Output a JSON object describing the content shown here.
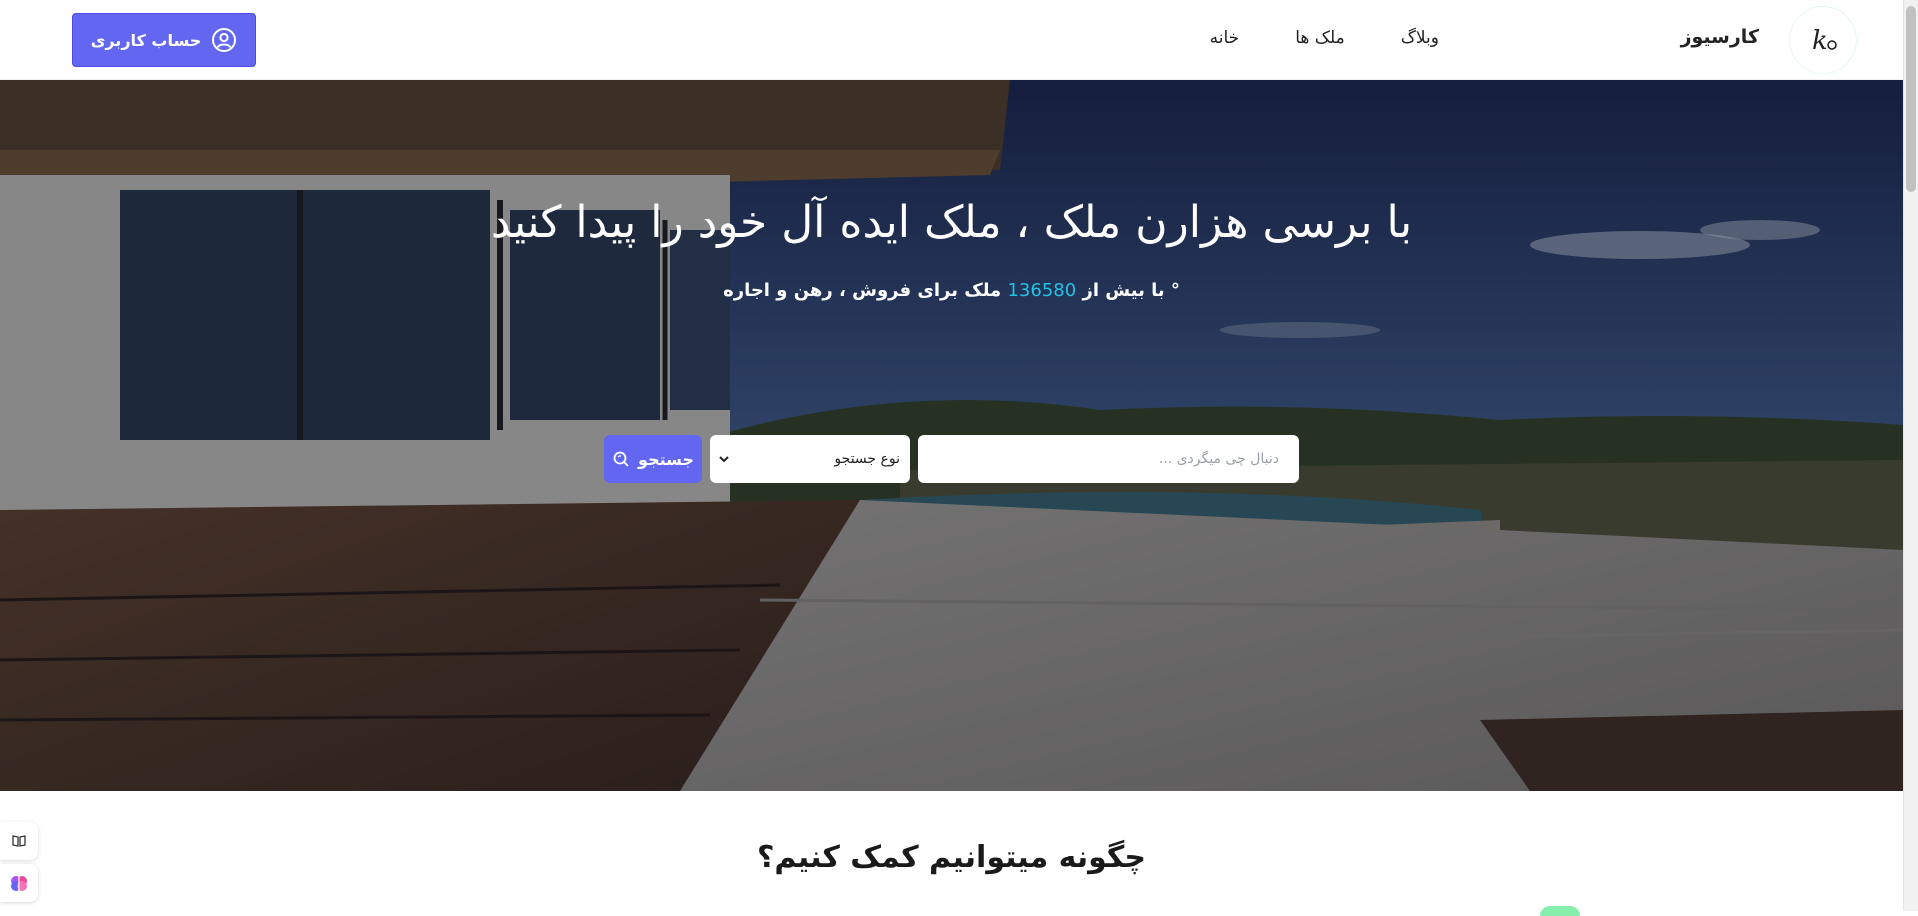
{
  "header": {
    "brand": "کارسیوز",
    "logo_icon": "k-logo-icon",
    "nav": [
      {
        "label": "خانه"
      },
      {
        "label": "ملک ها"
      },
      {
        "label": "وبلاگ"
      }
    ],
    "account_button": "حساب کاربری",
    "account_icon": "user-circle-icon"
  },
  "hero": {
    "title": "با برسی هزارن ملک ، ملک ایده آل خود را پیدا کنید",
    "sub_prefix": "با بیش از",
    "sub_count": "136580",
    "sub_suffix": "ملک برای فروش ، رهن و اجاره",
    "search_placeholder": "دنبال چی میگردی ...",
    "select_value": "نوع جستجو",
    "search_button": "جستجو"
  },
  "section": {
    "title": "چگونه میتوانیم کمک کنیم؟"
  },
  "colors": {
    "accent": "#6366f1",
    "count": "#22c3e6"
  }
}
